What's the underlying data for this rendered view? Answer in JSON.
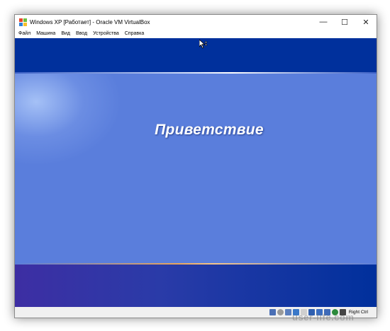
{
  "window": {
    "title": "Windows XP [Работает] - Oracle VM VirtualBox",
    "controls": {
      "minimize": "—",
      "maximize": "☐",
      "close": "✕"
    }
  },
  "menubar": {
    "items": [
      {
        "label": "Файл"
      },
      {
        "label": "Машина"
      },
      {
        "label": "Вид"
      },
      {
        "label": "Ввод"
      },
      {
        "label": "Устройства"
      },
      {
        "label": "Справка"
      }
    ]
  },
  "guest_screen": {
    "welcome_text": "Приветствие",
    "colors": {
      "top_band": "#00309c",
      "middle": "#5a7edc",
      "bottom_band_left": "#3d2ea3",
      "bottom_band_right": "#00309c"
    }
  },
  "statusbar": {
    "icons": [
      {
        "name": "hard-disk-icon",
        "color": "#4a6fb5"
      },
      {
        "name": "optical-drive-icon",
        "color": "#9a9a9a"
      },
      {
        "name": "audio-icon",
        "color": "#5b7fbf"
      },
      {
        "name": "network-icon",
        "color": "#3a78c8"
      },
      {
        "name": "usb-icon",
        "color": "#cfcfcf"
      },
      {
        "name": "shared-folders-icon",
        "color": "#2f5fb0"
      },
      {
        "name": "display-icon",
        "color": "#3a6ec2"
      },
      {
        "name": "video-capture-icon",
        "color": "#3f6bb8"
      },
      {
        "name": "virtualization-icon",
        "color": "#2c8a3c"
      },
      {
        "name": "mouse-integration-icon",
        "color": "#444444"
      }
    ],
    "host_key": "Right Ctrl"
  },
  "watermark": "user-life.com"
}
